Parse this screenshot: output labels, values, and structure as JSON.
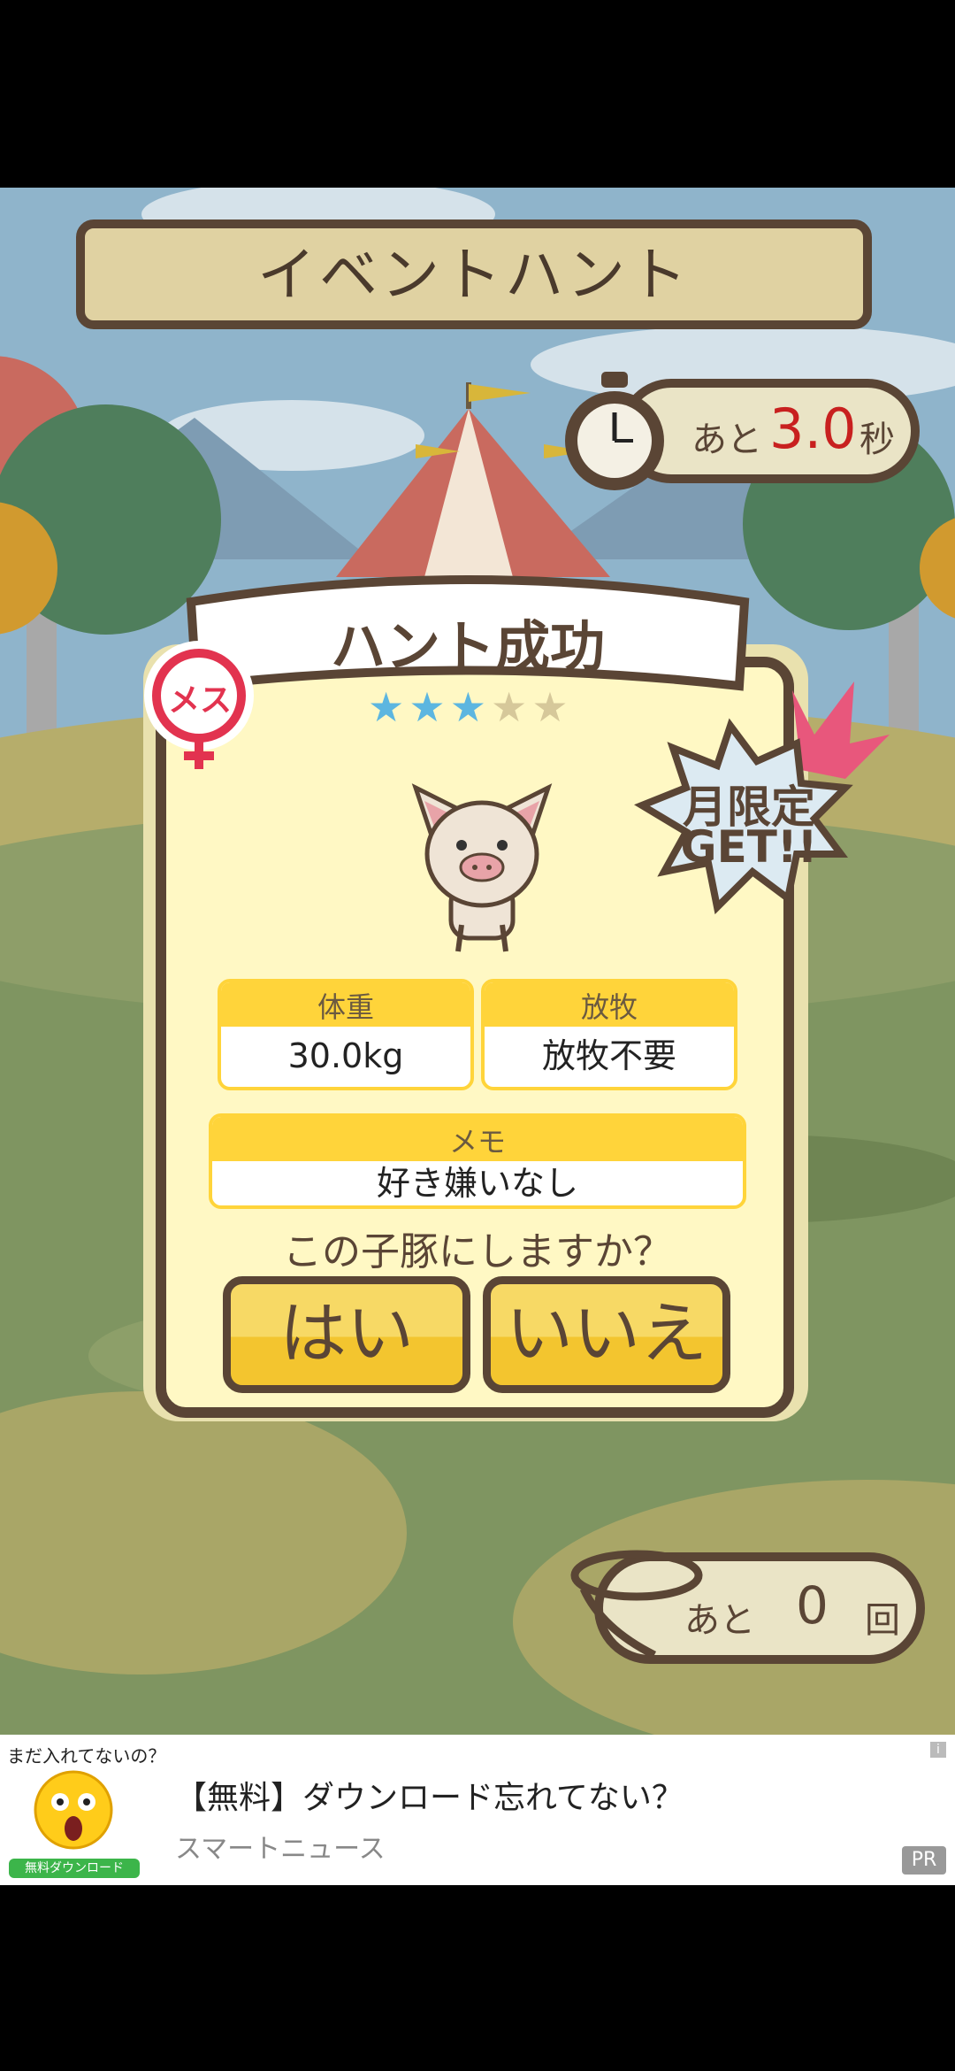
{
  "header": {
    "title": "イベントハント"
  },
  "timer": {
    "prefix": "あと",
    "value": "3.0",
    "unit": "秒"
  },
  "result": {
    "title": "ハント成功",
    "gender_label": "メス",
    "stars_filled": 3,
    "stars_total": 5,
    "badge_line1": "月限定",
    "badge_line2": "GET!!",
    "weight": {
      "label": "体重",
      "value": "30.0kg"
    },
    "pasture": {
      "label": "放牧",
      "value": "放牧不要"
    },
    "memo": {
      "label": "メモ",
      "value": "好き嫌いなし"
    },
    "question": "この子豚にしますか？",
    "yes_label": "はい",
    "no_label": "いいえ"
  },
  "remaining": {
    "prefix": "あと",
    "value": "0",
    "unit": "回"
  },
  "ad": {
    "caption": "まだ入れてないの？",
    "download_label": "無料ダウンロード",
    "title": "【無料】ダウンロード忘れてない？",
    "source": "スマートニュース",
    "pr_label": "PR",
    "info_label": "i"
  },
  "colors": {
    "accent_yellow": "#ffd43a",
    "wood": "#e0d2a2",
    "timer_red": "#c8201f",
    "star_blue": "#5cb6e0",
    "star_empty": "#d6c89a"
  }
}
